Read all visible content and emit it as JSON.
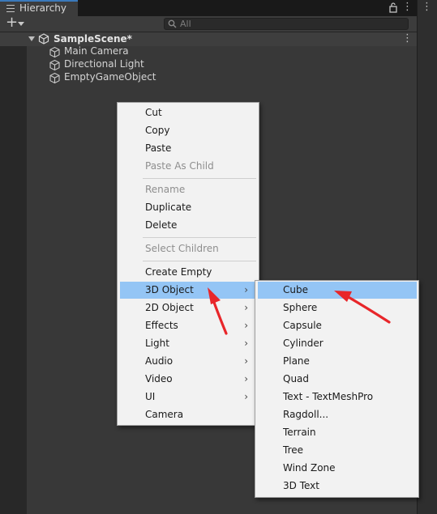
{
  "window": {
    "tab_title": "Hierarchy",
    "tab_icon": "hierarchy-list-icon",
    "lock_icon": "lock-icon",
    "more_icon": "kebab-menu-icon"
  },
  "toolbar": {
    "add_symbol": "+",
    "search_placeholder": "All"
  },
  "scene": {
    "name": "SampleScene*",
    "more_symbol": "⋮",
    "objects": [
      "Main Camera",
      "Directional Light",
      "EmptyGameObject"
    ]
  },
  "context_menu": {
    "items": [
      {
        "label": "Cut",
        "enabled": true
      },
      {
        "label": "Copy",
        "enabled": true
      },
      {
        "label": "Paste",
        "enabled": true
      },
      {
        "label": "Paste As Child",
        "enabled": false
      },
      {
        "label": "Rename",
        "enabled": false
      },
      {
        "label": "Duplicate",
        "enabled": true
      },
      {
        "label": "Delete",
        "enabled": true
      },
      {
        "label": "Select Children",
        "enabled": false
      },
      {
        "label": "Create Empty",
        "enabled": true
      },
      {
        "label": "3D Object",
        "enabled": true,
        "submenu": true,
        "highlighted": true
      },
      {
        "label": "2D Object",
        "enabled": true,
        "submenu": true
      },
      {
        "label": "Effects",
        "enabled": true,
        "submenu": true
      },
      {
        "label": "Light",
        "enabled": true,
        "submenu": true
      },
      {
        "label": "Audio",
        "enabled": true,
        "submenu": true
      },
      {
        "label": "Video",
        "enabled": true,
        "submenu": true
      },
      {
        "label": "UI",
        "enabled": true,
        "submenu": true
      },
      {
        "label": "Camera",
        "enabled": true
      }
    ],
    "submenu_arrow": "›"
  },
  "submenu_3d_object": {
    "items": [
      "Cube",
      "Sphere",
      "Capsule",
      "Cylinder",
      "Plane",
      "Quad",
      "Text - TextMeshPro",
      "Ragdoll...",
      "Terrain",
      "Tree",
      "Wind Zone",
      "3D Text"
    ],
    "highlighted": "Cube"
  },
  "colors": {
    "highlight": "#94c5f5",
    "annotation_arrow": "#e8262a",
    "tab_accent": "#3a79bb"
  }
}
